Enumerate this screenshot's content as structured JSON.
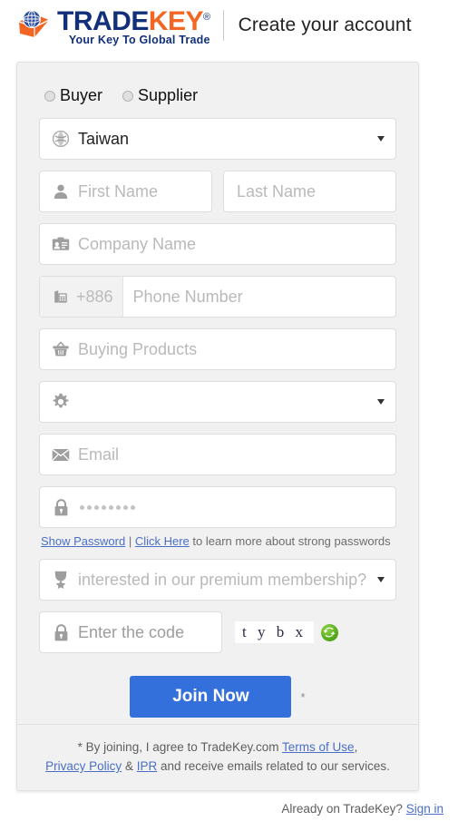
{
  "header": {
    "logo": {
      "brand_part1": "TRADE",
      "brand_part2": "KEY",
      "registered_mark": "®",
      "tagline": "Your Key To Global Trade",
      "color_navy": "#12307a",
      "color_orange": "#f26522"
    },
    "title": "Create your account"
  },
  "form": {
    "account_type": {
      "buyer_label": "Buyer",
      "supplier_label": "Supplier"
    },
    "country": {
      "value": "Taiwan",
      "icon": "globe-icon"
    },
    "first_name": {
      "placeholder": "First Name",
      "icon": "user-icon"
    },
    "last_name": {
      "placeholder": "Last Name"
    },
    "company": {
      "placeholder": "Company Name",
      "icon": "id-card-icon"
    },
    "phone": {
      "country_code": "+886",
      "placeholder": "Phone Number",
      "icon": "telephone-icon"
    },
    "buying_products": {
      "placeholder": "Buying Products",
      "icon": "basket-icon"
    },
    "business_type": {
      "value": "",
      "icon": "gear-icon"
    },
    "email": {
      "placeholder": "Email",
      "icon": "envelope-icon"
    },
    "password": {
      "masked_value": "••••••••",
      "icon": "lock-icon"
    },
    "password_help": {
      "show_password_link": "Show Password",
      "separator": "|",
      "click_here_link": "Click Here",
      "trailing_text": "to learn more about strong passwords"
    },
    "premium": {
      "value": "interested in our premium membership?",
      "icon": "medal-icon"
    },
    "captcha": {
      "placeholder": "Enter the code",
      "icon": "lock-icon",
      "code_image_text": "t y b x",
      "refresh_icon": "refresh-icon"
    },
    "submit": {
      "label": "Join Now",
      "required_marker": "*",
      "color": "#3470dc"
    }
  },
  "footer": {
    "line1_prefix": "* By joining, I agree to TradeKey.com ",
    "terms_link": "Terms of Use",
    "line1_suffix": ",",
    "privacy_link": "Privacy Policy",
    "amp": " & ",
    "ipr_link": "IPR",
    "line2_suffix": " and receive emails related to our services."
  },
  "signin": {
    "text": "Already on TradeKey?",
    "link": "Sign in"
  }
}
